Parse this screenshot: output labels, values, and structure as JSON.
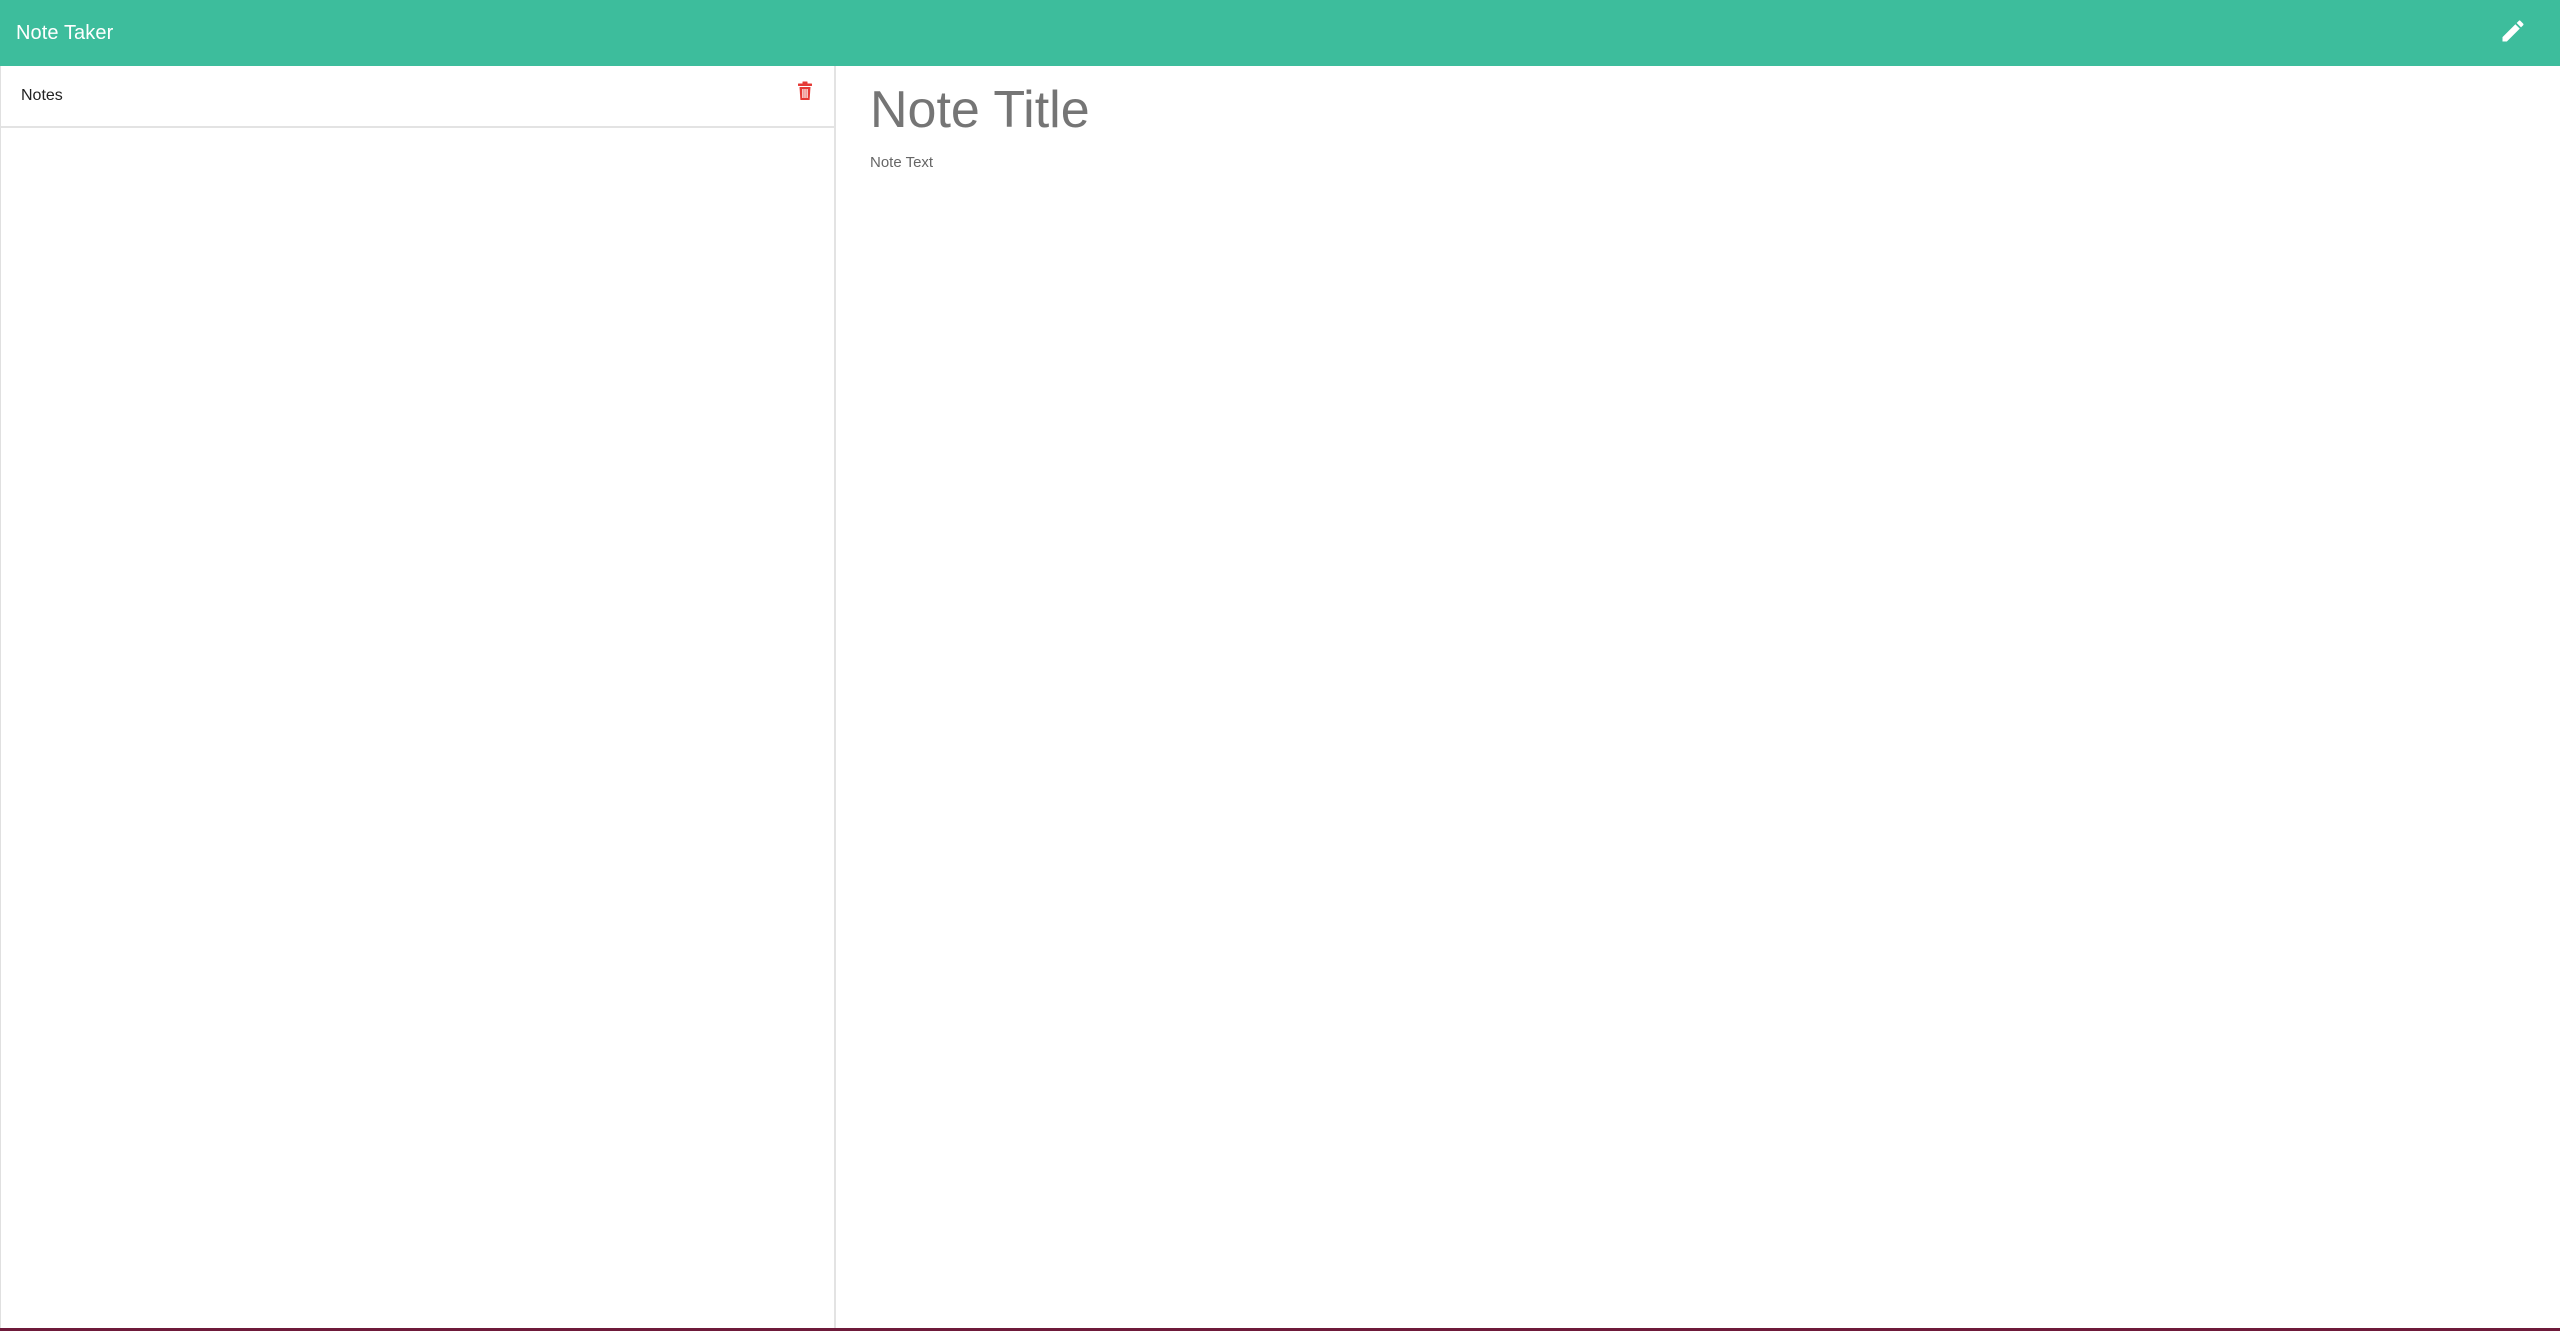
{
  "navbar": {
    "brand": "Note Taker",
    "new_note_icon": "pencil-icon",
    "background_color": "#3dbd9c"
  },
  "sidebar": {
    "items": [
      {
        "title": "Notes",
        "delete_icon": "trash-icon"
      }
    ]
  },
  "editor": {
    "title_placeholder": "Note Title",
    "text_placeholder": "Note Text"
  },
  "colors": {
    "accent": "#3dbd9c",
    "delete": "#e53935"
  }
}
